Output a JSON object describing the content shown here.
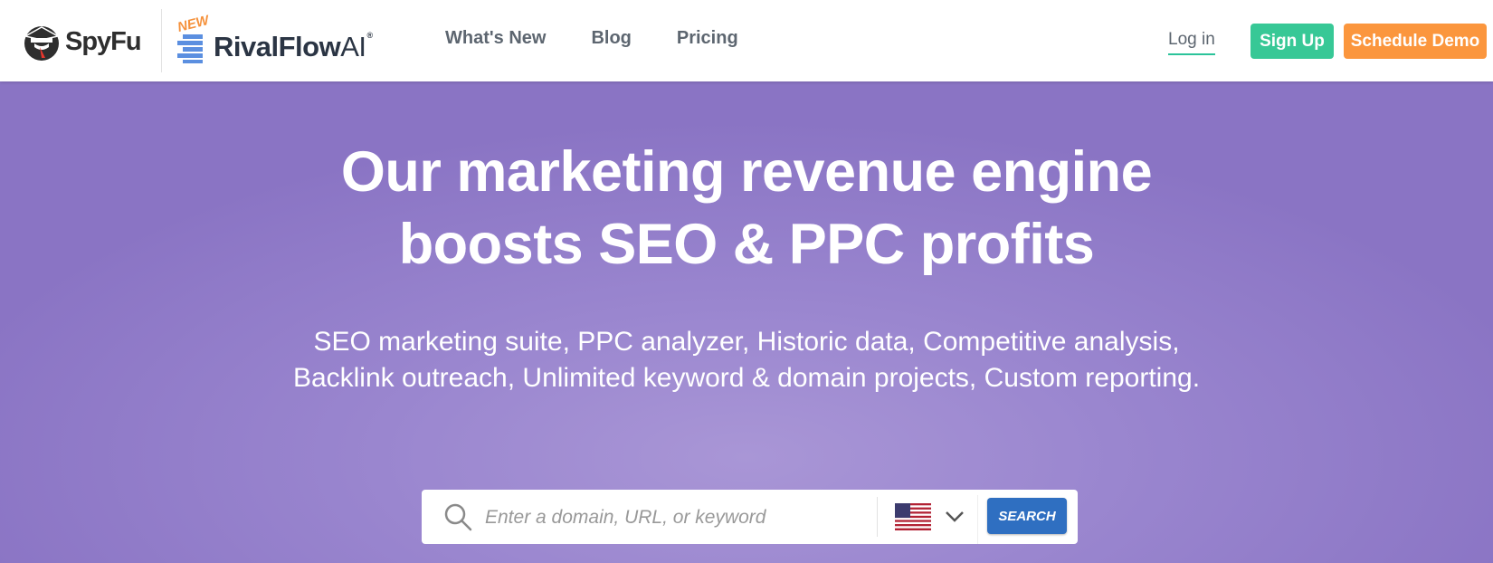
{
  "header": {
    "spyfu_logo_text": "SpyFu",
    "rivalflow_new_badge": "NEW",
    "rivalflow_logo_text": "RivalFlow",
    "rivalflow_logo_ai": "AI",
    "rivalflow_logo_reg": "®",
    "nav": [
      {
        "label": "What's New"
      },
      {
        "label": "Blog"
      },
      {
        "label": "Pricing"
      }
    ],
    "login_label": "Log in",
    "signup_label": "Sign Up",
    "demo_label": "Schedule Demo"
  },
  "hero": {
    "headline_line1": "Our marketing revenue engine",
    "headline_line2": "boosts SEO & PPC profits",
    "subhead": "SEO marketing suite, PPC analyzer, Historic data, Competitive analysis, Backlink outreach, Unlimited keyword & domain projects, Custom reporting."
  },
  "search": {
    "placeholder": "Enter a domain, URL, or keyword",
    "value": "",
    "country_icon": "us-flag-icon",
    "button_label": "SEARCH"
  },
  "colors": {
    "hero_bg": "#8a74c4",
    "signup_green": "#37c896",
    "demo_orange": "#fb963d",
    "search_blue": "#2f6fc1",
    "login_underline": "#2bc39a"
  }
}
